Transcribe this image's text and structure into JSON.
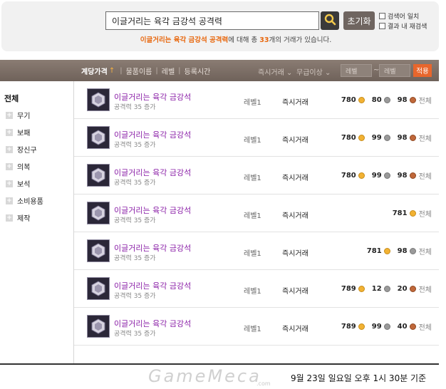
{
  "search": {
    "query": "이글거리는 육각 금강석 공격력",
    "reset_label": "초기화",
    "option_exact": "검색어 일치",
    "option_within": "결과 내 재검색",
    "summary_query": "이글거리는 육각 금강석 공격력",
    "summary_mid": "에 대해 총 ",
    "summary_count": "33",
    "summary_tail": "개의 거래가 있습니다."
  },
  "header": {
    "sort_price": "계당가격",
    "sort_price_arrow": "↑",
    "sort_name": "물품이름",
    "sort_level": "레벨",
    "sort_time": "등록시간",
    "trade_filter": "즉시거래 ⌄",
    "grade_filter": "무급이상 ⌄",
    "level_min_placeholder": "레벨",
    "level_max_placeholder": "레벨",
    "level_dash": "~",
    "apply_label": "적용"
  },
  "sidebar": {
    "all_label": "전체",
    "items": [
      {
        "label": "무기"
      },
      {
        "label": "보패"
      },
      {
        "label": "장신구"
      },
      {
        "label": "의복"
      },
      {
        "label": "보석"
      },
      {
        "label": "소비용품"
      },
      {
        "label": "제작"
      }
    ]
  },
  "listings": [
    {
      "name": "이글거리는 육각 금강석",
      "stat": "공격력 35 증가",
      "level": "레벨1",
      "trade": "즉시거래",
      "gold": "780",
      "silver": "80",
      "bronze": "98",
      "scope": "전체"
    },
    {
      "name": "이글거리는 육각 금강석",
      "stat": "공격력 35 증가",
      "level": "레벨1",
      "trade": "즉시거래",
      "gold": "780",
      "silver": "99",
      "bronze": "98",
      "scope": "전체"
    },
    {
      "name": "이글거리는 육각 금강석",
      "stat": "공격력 35 증가",
      "level": "레벨1",
      "trade": "즉시거래",
      "gold": "780",
      "silver": "99",
      "bronze": "98",
      "scope": "전체"
    },
    {
      "name": "이글거리는 육각 금강석",
      "stat": "공격력 35 증가",
      "level": "레벨1",
      "trade": "즉시거래",
      "gold": "781",
      "silver": "",
      "bronze": "",
      "scope": "전체"
    },
    {
      "name": "이글거리는 육각 금강석",
      "stat": "공격력 35 증가",
      "level": "레벨1",
      "trade": "즉시거래",
      "gold": "781",
      "silver": "98",
      "bronze": "",
      "scope": "전체"
    },
    {
      "name": "이글거리는 육각 금강석",
      "stat": "공격력 35 증가",
      "level": "레벨1",
      "trade": "즉시거래",
      "gold": "789",
      "silver": "12",
      "bronze": "20",
      "scope": "전체"
    },
    {
      "name": "이글거리는 육각 금강석",
      "stat": "공격력 35 증가",
      "level": "레벨1",
      "trade": "즉시거래",
      "gold": "789",
      "silver": "99",
      "bronze": "40",
      "scope": "전체"
    }
  ],
  "footer": {
    "watermark": "GameMeca",
    "watermark_domain": ".com",
    "timestamp": "9월 23일 일요일 오후 1시 30분 기준"
  },
  "colors": {
    "item_name": "#8b21a8",
    "accent": "#e8680f",
    "header_bar": "#7a6d65",
    "apply_button": "#e8662c"
  }
}
